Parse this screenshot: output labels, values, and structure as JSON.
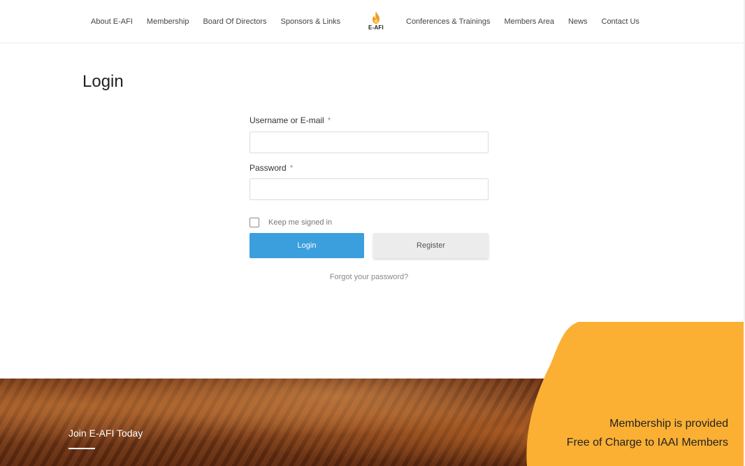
{
  "nav": {
    "left": [
      "About E-AFI",
      "Membership",
      "Board Of Directors",
      "Sponsors & Links"
    ],
    "right": [
      "Conferences & Trainings",
      "Members Area",
      "News",
      "Contact Us"
    ],
    "logo_text": "E-AFI"
  },
  "login": {
    "title": "Login",
    "username_label": "Username or E-mail",
    "password_label": "Password",
    "required_mark": "*",
    "username_value": "",
    "password_value": "",
    "keep_signed_in": "Keep me signed in",
    "login_button": "Login",
    "register_button": "Register",
    "forgot_link": "Forgot your password?"
  },
  "footer": {
    "join_text": "Join E-AFI Today",
    "promo_line1": "Membership is provided",
    "promo_line2": "Free of Charge to IAAI Members"
  },
  "colors": {
    "accent_blue": "#3a9fdc",
    "promo_yellow": "#fbb034",
    "flame_orange": "#f39a1f"
  }
}
